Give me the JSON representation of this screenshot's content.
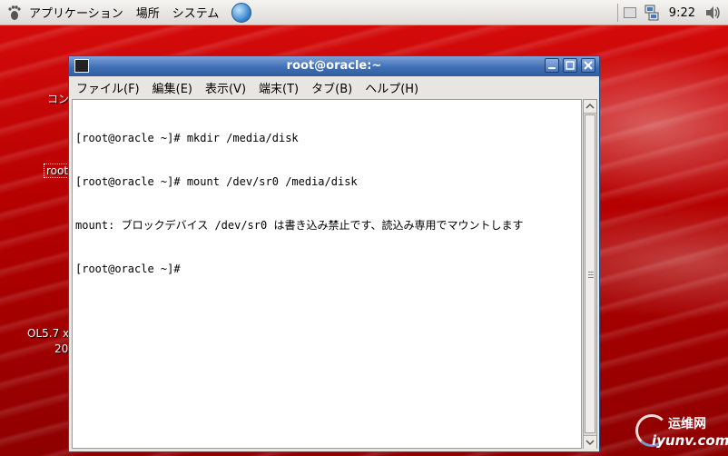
{
  "panel": {
    "menus": [
      "アプリケーション",
      "場所",
      "システム"
    ],
    "clock": "9:22"
  },
  "desktop": {
    "icon_labels": [
      "コン",
      "root",
      "OL5.7 x",
      "20"
    ]
  },
  "window": {
    "title": "root@oracle:~",
    "menu": [
      "ファイル(F)",
      "編集(E)",
      "表示(V)",
      "端末(T)",
      "タブ(B)",
      "ヘルプ(H)"
    ],
    "terminal_lines": [
      "[root@oracle ~]# mkdir /media/disk",
      "[root@oracle ~]# mount /dev/sr0 /media/disk",
      "mount: ブロックデバイス /dev/sr0 は書き込み禁止です、読込み専用でマウントします",
      "[root@oracle ~]#"
    ]
  },
  "watermark": {
    "cn": "运维网",
    "url": "iyunv.com"
  },
  "icons": {
    "foot": "gnome-foot-icon",
    "globe": "web-browser-icon",
    "network": "network-icon",
    "volume": "volume-icon"
  }
}
